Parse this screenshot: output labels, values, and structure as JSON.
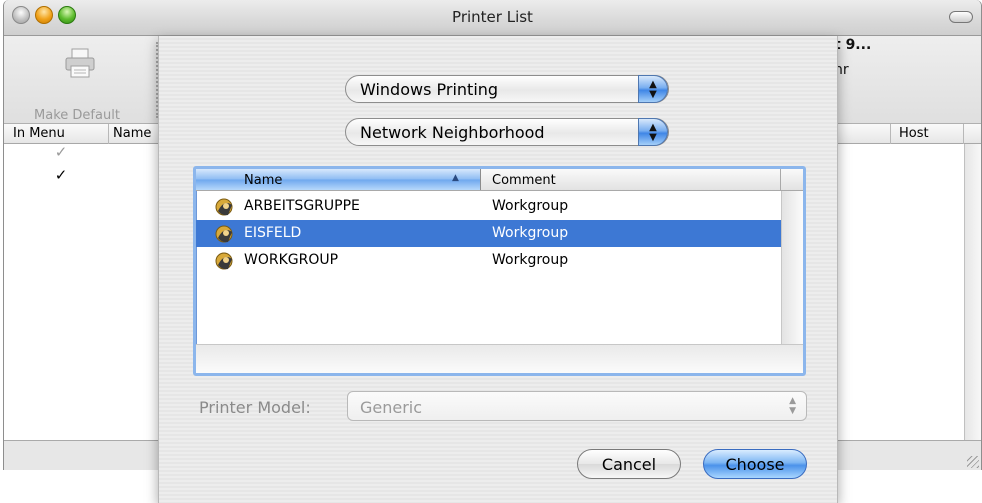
{
  "window": {
    "title": "Printer List"
  },
  "toolbar": {
    "make_default_label": "Make Default"
  },
  "printer_list": {
    "columns": {
      "in_menu": "In Menu",
      "name": "Name",
      "host": "Host"
    },
    "rows": [
      {
        "in_menu": true,
        "visible_text": "t 9..."
      },
      {
        "in_menu": true,
        "visible_text": "nr"
      }
    ]
  },
  "sheet": {
    "service_popup": "Windows Printing",
    "location_popup": "Network Neighborhood",
    "browser": {
      "columns": {
        "name": "Name",
        "comment": "Comment"
      },
      "rows": [
        {
          "name": "ARBEITSGRUPPE",
          "comment": "Workgroup",
          "selected": false
        },
        {
          "name": "EISFELD",
          "comment": "Workgroup",
          "selected": true
        },
        {
          "name": "WORKGROUP",
          "comment": "Workgroup",
          "selected": false
        }
      ]
    },
    "printer_model_label": "Printer Model:",
    "printer_model_value": "Generic",
    "cancel_label": "Cancel",
    "choose_label": "Choose"
  },
  "colors": {
    "selection": "#3d78d4",
    "accent_blue": "#4b92ea"
  }
}
